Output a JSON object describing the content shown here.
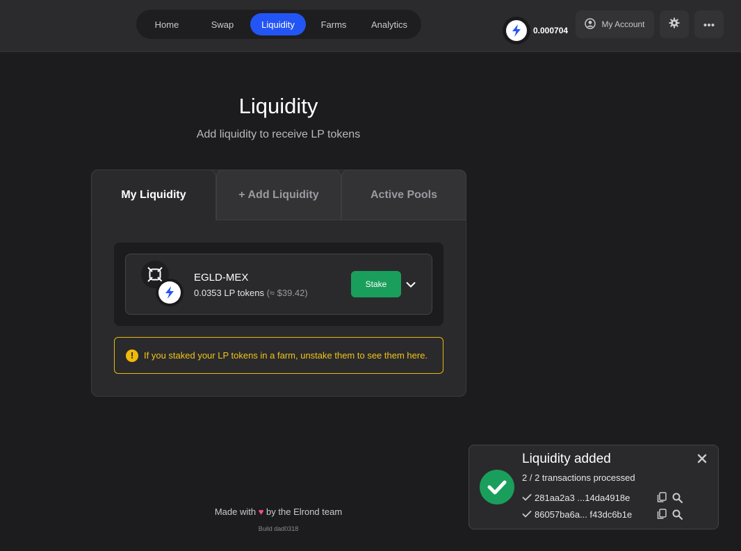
{
  "nav": {
    "items": [
      {
        "label": "Home",
        "active": false
      },
      {
        "label": "Swap",
        "active": false
      },
      {
        "label": "Liquidity",
        "active": true
      },
      {
        "label": "Farms",
        "active": false
      },
      {
        "label": "Analytics",
        "active": false
      }
    ]
  },
  "header": {
    "balance": "0.000704",
    "account_label": "My Account",
    "token_icon": "mex-lightning-icon",
    "settings_icon": "gear-icon",
    "more_icon": "more-dots-icon"
  },
  "page": {
    "title": "Liquidity",
    "subtitle": "Add liquidity to receive LP tokens"
  },
  "tabs": [
    {
      "label": "My Liquidity",
      "active": true
    },
    {
      "label": "+ Add Liquidity",
      "active": false
    },
    {
      "label": "Active Pools",
      "active": false
    }
  ],
  "pool": {
    "pair": "EGLD-MEX",
    "lp_amount": "0.0353 LP tokens",
    "usd_value": "(≈ $39.42)",
    "stake_label": "Stake",
    "token_a_icon": "egld-icon",
    "token_b_icon": "mex-lightning-icon"
  },
  "warning": {
    "text": "If you staked your LP tokens in a farm, unstake them to see them here."
  },
  "footer": {
    "made_prefix": "Made with",
    "made_suffix": "by the Elrond team",
    "build": "Build dad0318"
  },
  "toast": {
    "title": "Liquidity added",
    "subtitle": "2 / 2 transactions processed",
    "transactions": [
      {
        "hash": "281aa2a3 ...14da4918e"
      },
      {
        "hash": "86057ba6a... f43dc6b1e"
      }
    ]
  },
  "colors": {
    "accent_blue": "#2355f5",
    "success_green": "#1a9e5c",
    "warning_yellow": "#f0c419",
    "background": "#1c1c1e"
  }
}
